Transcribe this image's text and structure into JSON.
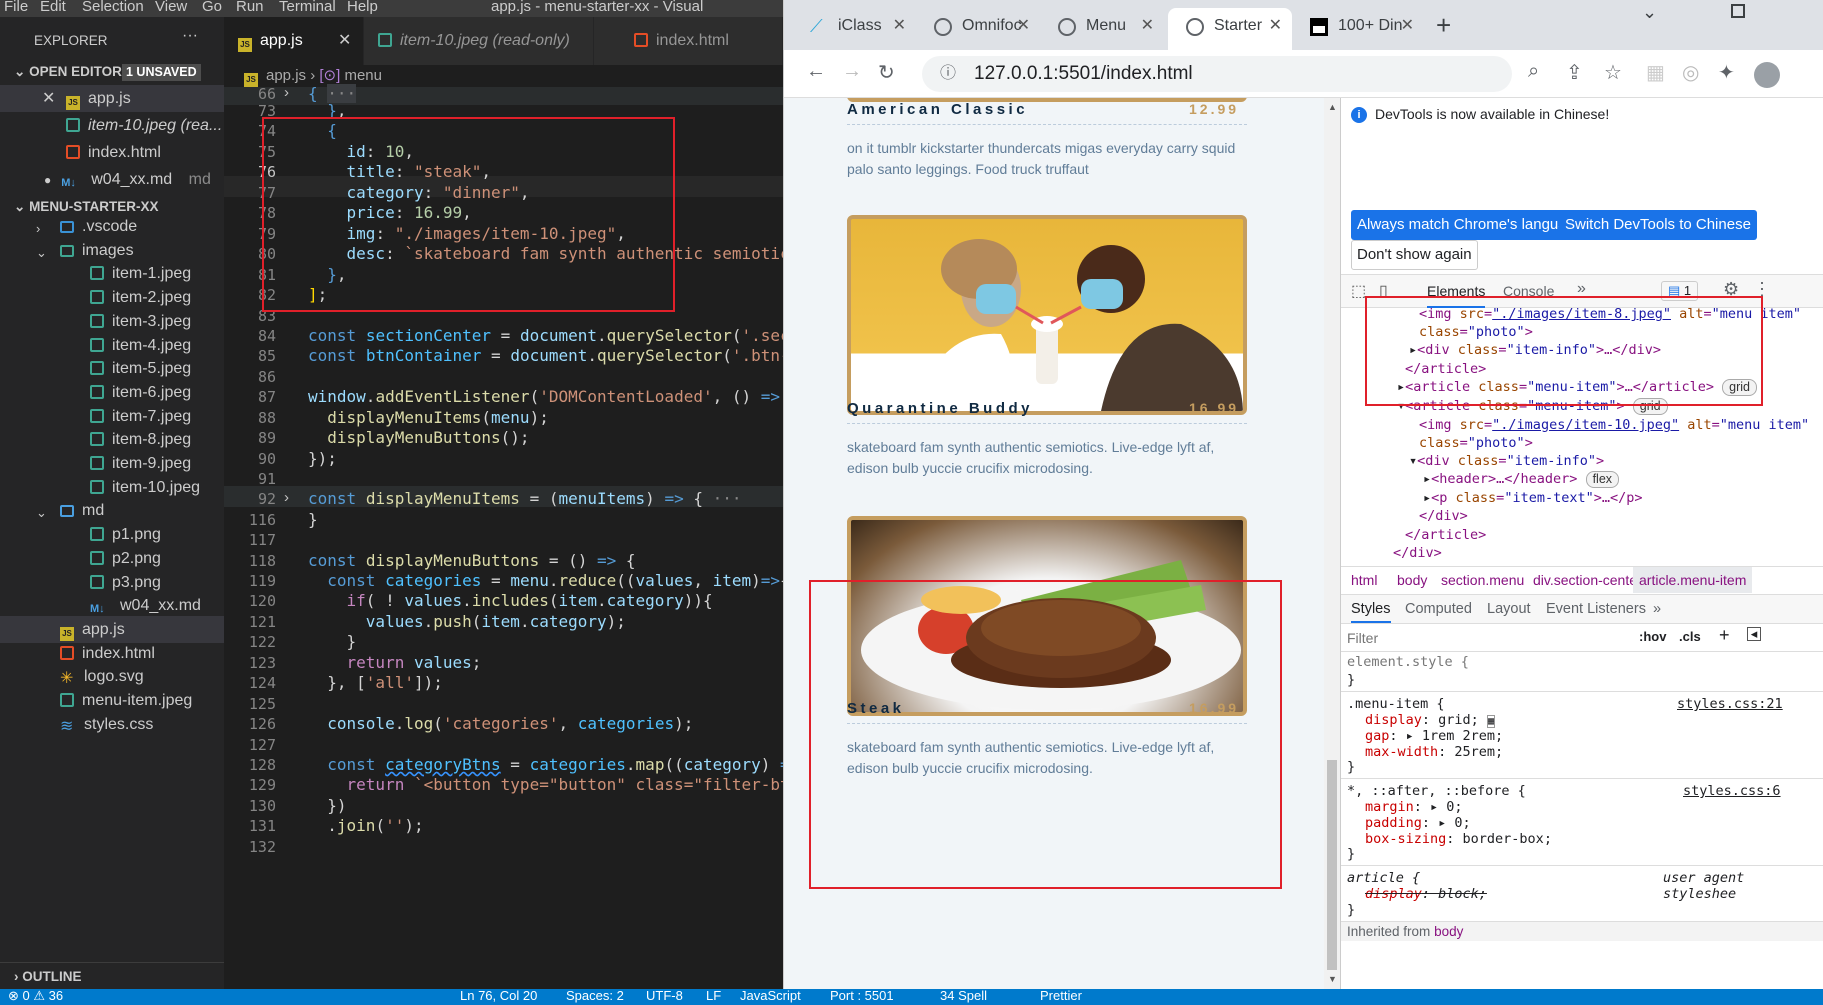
{
  "vscode": {
    "menu": [
      "File",
      "Edit",
      "Selection",
      "View",
      "Go",
      "Run",
      "Terminal",
      "Help"
    ],
    "window_title": "app.js - menu-starter-xx - Visual",
    "explorer_title": "EXPLORER",
    "open_editors": "OPEN EDITORS",
    "unsaved_badge": "1 UNSAVED",
    "open_files": [
      "app.js",
      "item-10.jpeg (rea...",
      "index.html",
      "w04_xx.md"
    ],
    "md_suffix": "md",
    "project": "MENU-STARTER-XX",
    "tree": [
      ".vscode",
      "images",
      "item-1.jpeg",
      "item-2.jpeg",
      "item-3.jpeg",
      "item-4.jpeg",
      "item-5.jpeg",
      "item-6.jpeg",
      "item-7.jpeg",
      "item-8.jpeg",
      "item-9.jpeg",
      "item-10.jpeg",
      "md",
      "p1.png",
      "p2.png",
      "p3.png",
      "w04_xx.md",
      "app.js",
      "index.html",
      "logo.svg",
      "menu-item.jpeg",
      "styles.css"
    ],
    "outline": "OUTLINE",
    "tabs": [
      "app.js",
      "item-10.jpeg (read-only)",
      "index.html"
    ],
    "breadcrumb_file": "app.js",
    "breadcrumb_symbol": "menu",
    "line_numbers": [
      "66",
      "73",
      "74",
      "75",
      "76",
      "77",
      "78",
      "79",
      "80",
      "81",
      "82",
      "83",
      "84",
      "85",
      "86",
      "87",
      "88",
      "89",
      "90",
      "91",
      "92",
      "116",
      "117",
      "118",
      "119",
      "120",
      "121",
      "122",
      "123",
      "124",
      "125",
      "126",
      "127",
      "128",
      "129",
      "130",
      "131",
      "132"
    ],
    "status": {
      "errors": "⊗ 0 ⚠ 36",
      "position": "Ln 76, Col 20",
      "spaces": "Spaces: 2",
      "encoding": "UTF-8",
      "eol": "LF",
      "language": "JavaScript",
      "port": "Port : 5501",
      "spell": "34 Spell",
      "prettier": "Prettier"
    }
  },
  "browser": {
    "tabs": [
      "iClass",
      "Omnifoc",
      "Menu",
      "Starter",
      "100+ Din"
    ],
    "url": "127.0.0.1:5501/index.html",
    "items": [
      {
        "title": "American Classic",
        "price": "12.99",
        "desc": "on it tumblr kickstarter thundercats migas everyday carry squid palo santo leggings. Food truck truffaut"
      },
      {
        "title": "Quarantine Buddy",
        "price": "16.99",
        "desc": "skateboard fam synth authentic semiotics. Live-edge lyft af, edison bulb yuccie crucifix microdosing."
      },
      {
        "title": "Steak",
        "price": "16.99",
        "desc": "skateboard fam synth authentic semiotics. Live-edge lyft af, edison bulb yuccie crucifix microdosing."
      }
    ]
  },
  "devtools": {
    "notice": "DevTools is now available in Chinese!",
    "btn_match": "Always match Chrome's language",
    "btn_switch": "Switch DevTools to Chinese",
    "btn_dont": "Don't show again",
    "tabs": [
      "Elements",
      "Console"
    ],
    "issues": "1",
    "crumbs": [
      "html",
      "body",
      "section.menu",
      "div.section-center",
      "article.menu-item"
    ],
    "style_tabs": [
      "Styles",
      "Computed",
      "Layout",
      "Event Listeners"
    ],
    "filter_placeholder": "Filter",
    "hov": ":hov",
    "cls": ".cls",
    "styles_src1": "styles.css:21",
    "styles_src2": "styles.css:6",
    "ua": "user agent styleshee",
    "inherited": "Inherited from",
    "inherited_el": "body"
  },
  "colors": {
    "vscode_bg": "#1e1e1e",
    "status": "#007acc",
    "brand_gold": "#c59d5f",
    "highlight": "#e0202a"
  }
}
